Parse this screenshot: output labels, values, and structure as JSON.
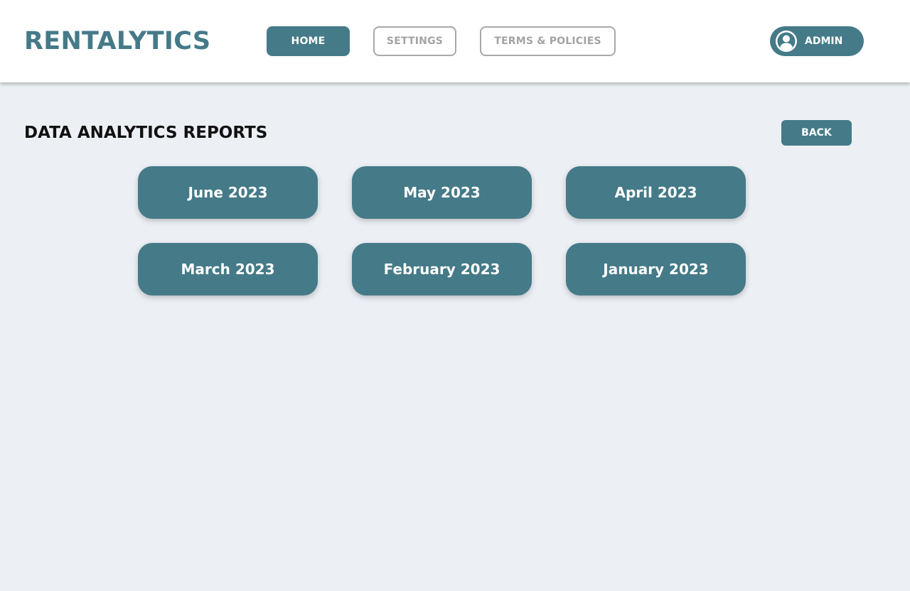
{
  "header": {
    "logo": "RENTALYTICS",
    "nav": {
      "home": "HOME",
      "settings": "SETTINGS",
      "terms": "TERMS & POLICIES"
    },
    "user": {
      "label": "ADMIN",
      "icon": "user-circle-icon"
    }
  },
  "main": {
    "title": "DATA ANALYTICS REPORTS",
    "back_label": "BACK",
    "reports": [
      "June 2023",
      "May 2023",
      "April 2023",
      "March 2023",
      "February 2023",
      "January 2023"
    ]
  },
  "colors": {
    "accent": "#457a88",
    "background": "#ecf0f5",
    "header_bg": "#ffffff",
    "outline_gray": "#a8a8a8"
  }
}
